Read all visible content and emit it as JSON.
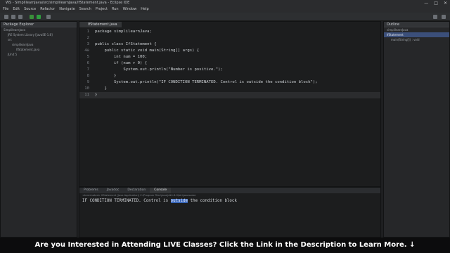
{
  "window": {
    "title": "WS - SimplilearnJava/src/simplilearnJava/IfStatement.java - Eclipse IDE",
    "min_icon": "minimize-icon",
    "max_icon": "maximize-icon",
    "close_icon": "close-icon"
  },
  "menu": [
    "File",
    "Edit",
    "Source",
    "Refactor",
    "Navigate",
    "Search",
    "Project",
    "Run",
    "Window",
    "Help"
  ],
  "left_panel": {
    "tab_label": "Package Explorer",
    "items": [
      "SimplilearnJava",
      "JRE System Library [JavaSE-1.8]",
      "src",
      "simplilearnJava",
      "IfStatement.java",
      "JUnit 5"
    ]
  },
  "editor": {
    "tab_label": "IfStatement.java",
    "code_lines": [
      {
        "n": "1",
        "text": "package simplilearnJava;"
      },
      {
        "n": "2",
        "text": ""
      },
      {
        "n": "3",
        "text": "public class IfStatement {"
      },
      {
        "n": "4⊖",
        "text": "    public static void main(String[] args) {"
      },
      {
        "n": "5",
        "text": "        int num = 100;"
      },
      {
        "n": "6",
        "text": "        if (num > 0) {"
      },
      {
        "n": "7",
        "text": "            System.out.println(\"Number is positive.\");"
      },
      {
        "n": "8",
        "text": "        }"
      },
      {
        "n": "9",
        "text": "        System.out.println(\"IF CONDITION TERMINATED. Control is outside the condition block\");"
      },
      {
        "n": "10",
        "text": "    }"
      },
      {
        "n": "11",
        "text": "}"
      }
    ]
  },
  "console": {
    "tabs": [
      "Problems",
      "Javadoc",
      "Declaration",
      "Console"
    ],
    "active_tab": "Console",
    "info": "<terminated> IfStatement [Java Application] C:\\Program Files\\Java\\jdk1.8.0\\bin\\javaw.exe",
    "output_before": "IF CONDITION TERMINATED. Control is ",
    "output_selected": "outside",
    "output_after": " the condition block"
  },
  "outline": {
    "tab_label": "Outline",
    "items": [
      "simplilearnJava",
      "IfStatement",
      "main(String[]) : void"
    ]
  },
  "banner": {
    "text": "Are you Interested in Attending LIVE Classes? Click the Link in the Description to Learn More.",
    "arrow_icon": "down-arrow-icon"
  }
}
